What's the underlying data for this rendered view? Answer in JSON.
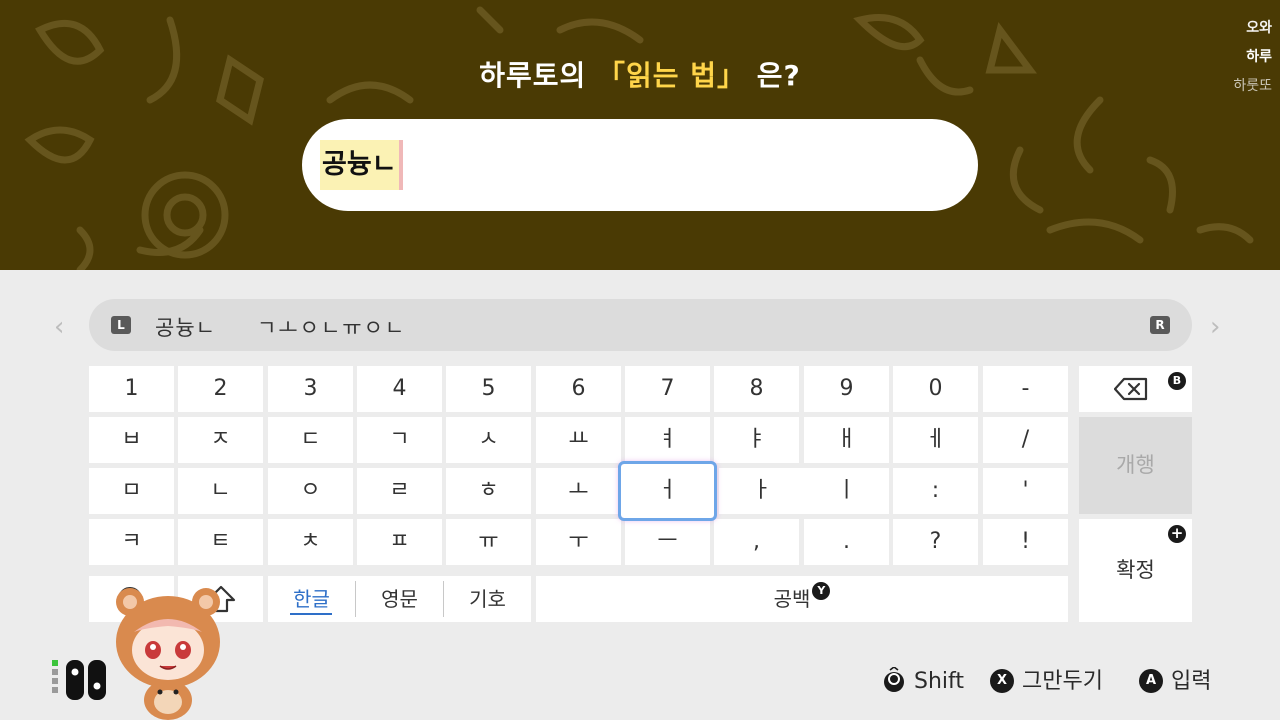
{
  "top": {
    "question_before": "하루토의 ",
    "question_highlight": "「읽는 법」",
    "question_after": " 은?",
    "answer_text": "공늉ㄴ",
    "comments": [
      "오와",
      "하루",
      "하룻또"
    ]
  },
  "keyboard": {
    "candidates": {
      "l_button": "L",
      "r_button": "R",
      "items": [
        "공늉ㄴ",
        "ㄱㅗㅇㄴㅠㅇㄴ"
      ]
    },
    "rows": [
      [
        "1",
        "2",
        "3",
        "4",
        "5",
        "6",
        "7",
        "8",
        "9",
        "0",
        "-"
      ],
      [
        "ㅂ",
        "ㅈ",
        "ㄷ",
        "ㄱ",
        "ㅅ",
        "ㅛ",
        "ㅕ",
        "ㅑ",
        "ㅐ",
        "ㅔ",
        "/"
      ],
      [
        "ㅁ",
        "ㄴ",
        "ㅇ",
        "ㄹ",
        "ㅎ",
        "ㅗ",
        "ㅓ",
        "ㅏ",
        "ㅣ",
        ":",
        "'"
      ],
      [
        "ㅋ",
        "ㅌ",
        "ㅊ",
        "ㅍ",
        "ㅠ",
        "ㅜ",
        "ㅡ",
        ",",
        ".",
        "?",
        "!"
      ]
    ],
    "selected_key": "ㅓ",
    "backspace_button": "B",
    "newline_label": "개행",
    "confirm_label": "확정",
    "confirm_button": "+",
    "mode_tabs": [
      "한글",
      "영문",
      "기호"
    ],
    "active_tab": "한글",
    "space_label": "공백",
    "space_button": "Y"
  },
  "footer": {
    "shift": "Shift",
    "cancel_button": "X",
    "cancel": "그만두기",
    "enter_button": "A",
    "enter": "입력"
  },
  "colors": {
    "top_bg": "#4a3a04",
    "highlight": "#ffd54a",
    "keyboard_bg": "#ececec",
    "active_tab": "#2e6fc8"
  }
}
